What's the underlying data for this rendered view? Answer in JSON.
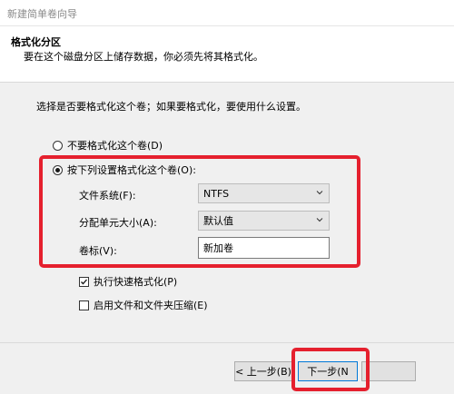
{
  "window": {
    "title": "新建简单卷向导"
  },
  "header": {
    "title": "格式化分区",
    "subtitle": "要在这个磁盘分区上储存数据，你必须先将其格式化。"
  },
  "content": {
    "intro": "选择是否要格式化这个卷；如果要格式化，要使用什么设置。",
    "options": {
      "no_format": {
        "label": "不要格式化这个卷(D)",
        "checked": false
      },
      "format": {
        "label": "按下列设置格式化这个卷(O):",
        "checked": true
      }
    },
    "filesystem": {
      "label": "文件系统(F):",
      "value": "NTFS"
    },
    "allocation": {
      "label": "分配单元大小(A):",
      "value": "默认值"
    },
    "volume_label": {
      "label": "卷标(V):",
      "value": "新加卷"
    },
    "quick_format": {
      "label": "执行快速格式化(P)",
      "checked": true
    },
    "compression": {
      "label": "启用文件和文件夹压缩(E)",
      "checked": false
    }
  },
  "footer": {
    "back_label": "< 上一步(B)",
    "next_label": "下一步(N"
  },
  "colors": {
    "highlight": "#e5202e",
    "accent": "#0078d7"
  }
}
